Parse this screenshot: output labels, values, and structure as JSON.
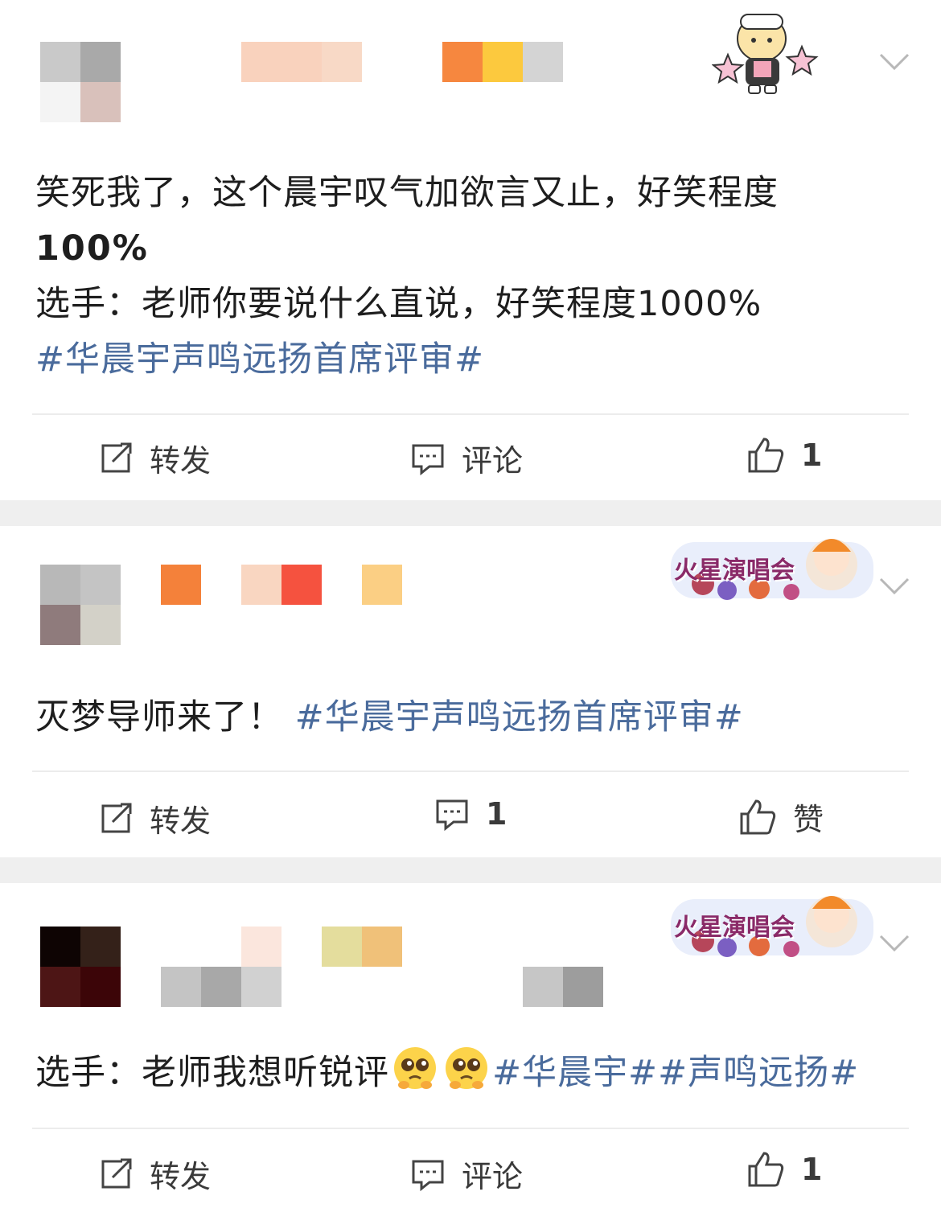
{
  "posts": [
    {
      "text_line1": "笑死我了，这个晨宇叹气加欲言又止，好笑程度",
      "text_line2": "100%",
      "text_line3": "选手：老师你要说什么直说，好笑程度1000%",
      "hashtag": "#华晨宇声鸣远扬首席评审#",
      "actions": {
        "repost": "转发",
        "comment": "评论",
        "like": "1"
      }
    },
    {
      "text": "灭梦导师来了！",
      "hashtag": "#华晨宇声鸣远扬首席评审#",
      "badge_text": "火星演唱会",
      "actions": {
        "repost": "转发",
        "comment": "1",
        "like": "赞"
      }
    },
    {
      "text": "选手：老师我想听锐评",
      "hashtag1": "#华晨宇#",
      "hashtag2": "#声鸣远扬#",
      "badge_text": "火星演唱会",
      "actions": {
        "repost": "转发",
        "comment": "评论",
        "like": "1"
      }
    }
  ],
  "colors": {
    "hashtag": "#4a6b9c",
    "separator": "#efefef",
    "action_text": "#3a3a3a"
  },
  "icons": [
    "repost-icon",
    "comment-icon",
    "thumbs-up-icon",
    "chevron-down-icon",
    "pleading-face-emoji"
  ]
}
